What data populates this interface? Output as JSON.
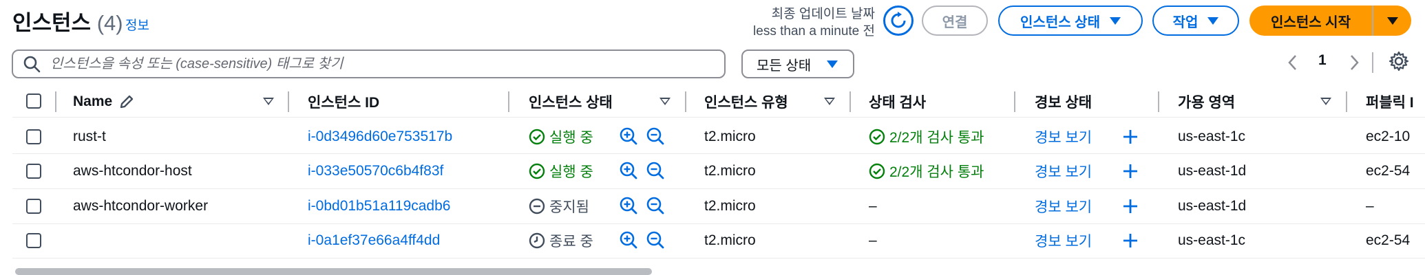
{
  "header": {
    "title": "인스턴스",
    "count": "(4)",
    "info_link": "정보",
    "last_updated_label": "최종 업데이트 날짜",
    "last_updated_value": "less than a minute 전",
    "buttons": {
      "connect": "연결",
      "instance_state": "인스턴스 상태",
      "actions": "작업",
      "launch": "인스턴스 시작"
    }
  },
  "filter": {
    "search_placeholder": "인스턴스을 속성 또는 (case-sensitive) 태그로 찾기",
    "state_select": "모든 상태"
  },
  "pagination": {
    "current_page": "1"
  },
  "table": {
    "columns": [
      "Name",
      "인스턴스 ID",
      "인스턴스 상태",
      "인스턴스 유형",
      "상태 검사",
      "경보 상태",
      "가용 영역",
      "퍼블릭 I"
    ],
    "rows": [
      {
        "name": "rust-t",
        "id": "i-0d3496d60e753517b",
        "state": "실행 중",
        "state_kind": "running",
        "type": "t2.micro",
        "check": "2/2개 검사 통과",
        "check_ok": true,
        "alarm": "경보 보기",
        "az": "us-east-1c",
        "public": "ec2-10"
      },
      {
        "name": "aws-htcondor-host",
        "id": "i-033e50570c6b4f83f",
        "state": "실행 중",
        "state_kind": "running",
        "type": "t2.micro",
        "check": "2/2개 검사 통과",
        "check_ok": true,
        "alarm": "경보 보기",
        "az": "us-east-1d",
        "public": "ec2-54"
      },
      {
        "name": "aws-htcondor-worker",
        "id": "i-0bd01b51a119cadb6",
        "state": "중지됨",
        "state_kind": "stopped",
        "type": "t2.micro",
        "check": "–",
        "check_ok": false,
        "alarm": "경보 보기",
        "az": "us-east-1d",
        "public": "–"
      },
      {
        "name": "",
        "id": "i-0a1ef37e66a4ff4dd",
        "state": "종료 중",
        "state_kind": "terminating",
        "type": "t2.micro",
        "check": "–",
        "check_ok": false,
        "alarm": "경보 보기",
        "az": "us-east-1c",
        "public": "ec2-54"
      }
    ]
  },
  "colors": {
    "link": "#006ce0",
    "success": "#037f0c",
    "primary": "#ff9900"
  },
  "icons": [
    "refresh-icon",
    "search-icon",
    "gear-icon",
    "edit-icon",
    "zoom-in-icon",
    "zoom-out-icon",
    "plus-icon",
    "check-circle-icon",
    "stopped-icon",
    "pending-icon"
  ]
}
